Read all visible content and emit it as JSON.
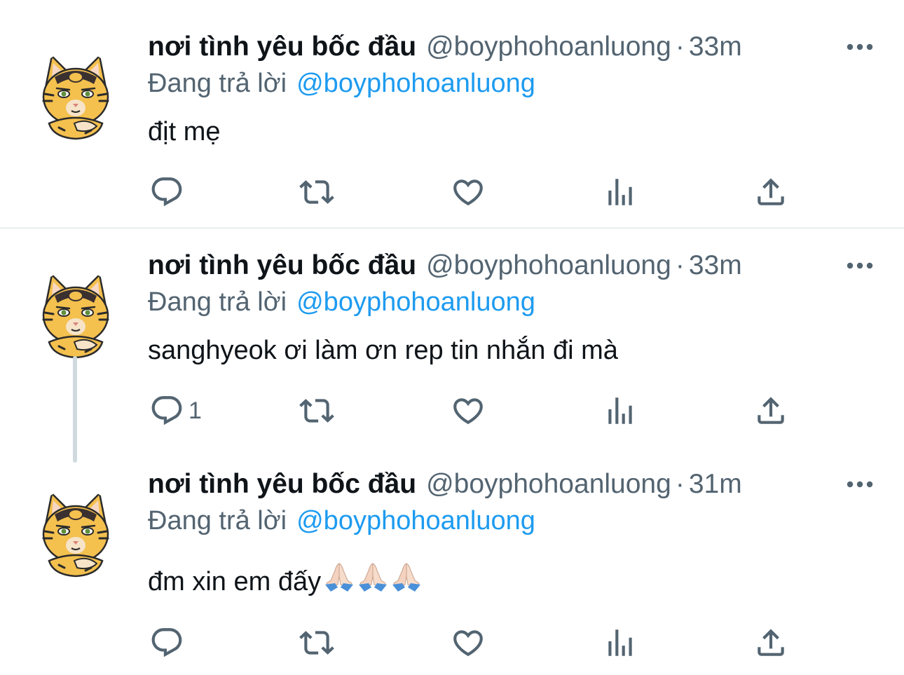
{
  "colors": {
    "text": "#0f1419",
    "secondary": "#536471",
    "link": "#1d9bf0",
    "thread_line": "#cfd9de"
  },
  "tweets": [
    {
      "display_name": "nơi tình yêu bốc đầu",
      "handle": "@boyphohoanluong",
      "separator": "·",
      "time": "33m",
      "reply_prefix": "Đang trả lời",
      "reply_to": "@boyphohoanluong",
      "text": "địt mẹ",
      "reply_count": "",
      "icons": [
        "reply-icon",
        "retweet-icon",
        "like-icon",
        "views-icon",
        "share-icon",
        "more-icon"
      ]
    },
    {
      "display_name": "nơi tình yêu bốc đầu",
      "handle": "@boyphohoanluong",
      "separator": "·",
      "time": "33m",
      "reply_prefix": "Đang trả lời",
      "reply_to": "@boyphohoanluong",
      "text": "sanghyeok ơi làm ơn rep tin nhắn đi mà",
      "reply_count": "1",
      "icons": [
        "reply-icon",
        "retweet-icon",
        "like-icon",
        "views-icon",
        "share-icon",
        "more-icon"
      ]
    },
    {
      "display_name": "nơi tình yêu bốc đầu",
      "handle": "@boyphohoanluong",
      "separator": "·",
      "time": "31m",
      "reply_prefix": "Đang trả lời",
      "reply_to": "@boyphohoanluong",
      "text": "đm xin em đấy",
      "emoji": "🙏🏻🙏🏻🙏🏻",
      "reply_count": "",
      "icons": [
        "reply-icon",
        "retweet-icon",
        "like-icon",
        "views-icon",
        "share-icon",
        "more-icon"
      ]
    }
  ]
}
